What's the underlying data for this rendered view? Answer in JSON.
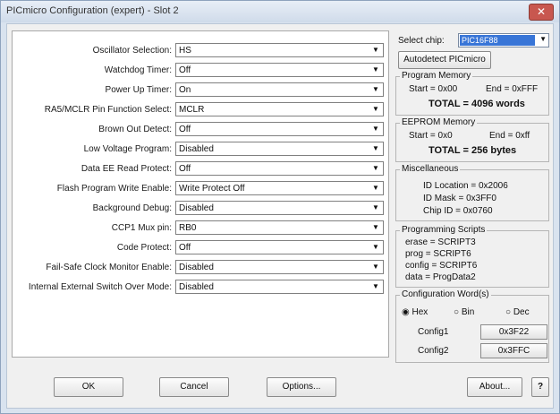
{
  "window": {
    "title": "PICmicro Configuration (expert) - Slot 2",
    "close_glyph": "✕"
  },
  "settings": [
    {
      "label": "Oscillator Selection:",
      "value": "HS"
    },
    {
      "label": "Watchdog Timer:",
      "value": "Off"
    },
    {
      "label": "Power Up Timer:",
      "value": "On"
    },
    {
      "label": "RA5/MCLR Pin Function Select:",
      "value": "MCLR"
    },
    {
      "label": "Brown Out Detect:",
      "value": "Off"
    },
    {
      "label": "Low Voltage Program:",
      "value": "Disabled"
    },
    {
      "label": "Data EE Read Protect:",
      "value": "Off"
    },
    {
      "label": "Flash Program Write Enable:",
      "value": "Write Protect Off"
    },
    {
      "label": "Background Debug:",
      "value": "Disabled"
    },
    {
      "label": "CCP1 Mux pin:",
      "value": "RB0"
    },
    {
      "label": "Code Protect:",
      "value": "Off"
    },
    {
      "label": "Fail-Safe Clock Monitor Enable:",
      "value": "Disabled"
    },
    {
      "label": "Internal External Switch Over Mode:",
      "value": "Disabled"
    }
  ],
  "chip": {
    "label": "Select chip:",
    "value": "PIC16F88",
    "autodetect_label": "Autodetect PICmicro"
  },
  "program_memory": {
    "title": "Program Memory",
    "start": "Start = 0x00",
    "end": "End = 0xFFF",
    "total": "TOTAL = 4096 words"
  },
  "eeprom_memory": {
    "title": "EEPROM Memory",
    "start": "Start = 0x0",
    "end": "End = 0xff",
    "total": "TOTAL = 256 bytes"
  },
  "misc": {
    "title": "Miscellaneous",
    "id_location": "ID Location = 0x2006",
    "id_mask": "ID Mask = 0x3FF0",
    "chip_id": "Chip ID = 0x0760"
  },
  "scripts": {
    "title": "Programming Scripts",
    "erase": "erase = SCRIPT3",
    "prog": "prog = SCRIPT6",
    "config": "config = SCRIPT6",
    "data": "data = ProgData2"
  },
  "config_words": {
    "title": "Configuration Word(s)",
    "radios": [
      "Hex",
      "Bin",
      "Dec"
    ],
    "selected": "Hex",
    "items": [
      {
        "label": "Config1",
        "value": "0x3F22"
      },
      {
        "label": "Config2",
        "value": "0x3FFC"
      }
    ]
  },
  "buttons": {
    "ok": "OK",
    "cancel": "Cancel",
    "options": "Options...",
    "about": "About...",
    "help": "?"
  }
}
